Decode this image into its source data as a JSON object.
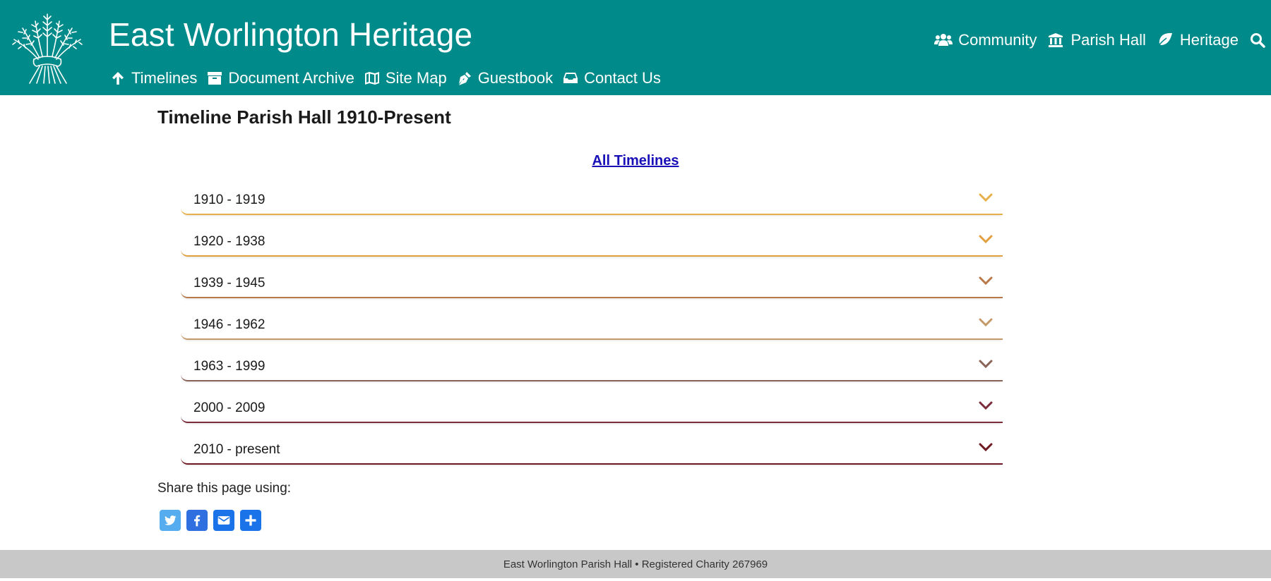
{
  "header": {
    "site_title": "East Worlington Heritage",
    "logo": "wheat-sheaf-logo",
    "background_color": "#008b8a",
    "top_nav": [
      {
        "label": "Community",
        "icon": "users-icon"
      },
      {
        "label": "Parish Hall",
        "icon": "landmark-icon"
      },
      {
        "label": "Heritage",
        "icon": "leaf-icon"
      }
    ],
    "search_icon": "search-icon",
    "sub_nav": [
      {
        "label": "Timelines",
        "icon": "arrow-up-icon"
      },
      {
        "label": "Document Archive",
        "icon": "archive-box-icon"
      },
      {
        "label": "Site Map",
        "icon": "map-icon"
      },
      {
        "label": "Guestbook",
        "icon": "pen-nib-icon"
      },
      {
        "label": "Contact Us",
        "icon": "inbox-icon"
      }
    ]
  },
  "main": {
    "page_title": "Timeline Parish Hall 1910-Present",
    "all_timelines_link": "All Timelines",
    "accordion": [
      {
        "label": "1910 - 1919",
        "color": "#e8b04a"
      },
      {
        "label": "1920 - 1938",
        "color": "#e0a040"
      },
      {
        "label": "1939 - 1945",
        "color": "#b87a4a"
      },
      {
        "label": "1946 - 1962",
        "color": "#c49a6a"
      },
      {
        "label": "1963 - 1999",
        "color": "#8a6458"
      },
      {
        "label": "2000 - 2009",
        "color": "#7a2c3a"
      },
      {
        "label": "2010 - present",
        "color": "#6e1a22"
      }
    ],
    "share": {
      "label": "Share this page using:",
      "buttons": [
        {
          "name": "twitter",
          "icon": "twitter-icon",
          "color": "#55acee"
        },
        {
          "name": "facebook",
          "icon": "facebook-icon",
          "color": "#2f6fe0"
        },
        {
          "name": "email",
          "icon": "email-icon",
          "color": "#1a73e8"
        },
        {
          "name": "more",
          "icon": "plus-icon",
          "color": "#1a73e8"
        }
      ]
    }
  },
  "footer": {
    "text": "East Worlington Parish Hall • Registered Charity 267969"
  }
}
